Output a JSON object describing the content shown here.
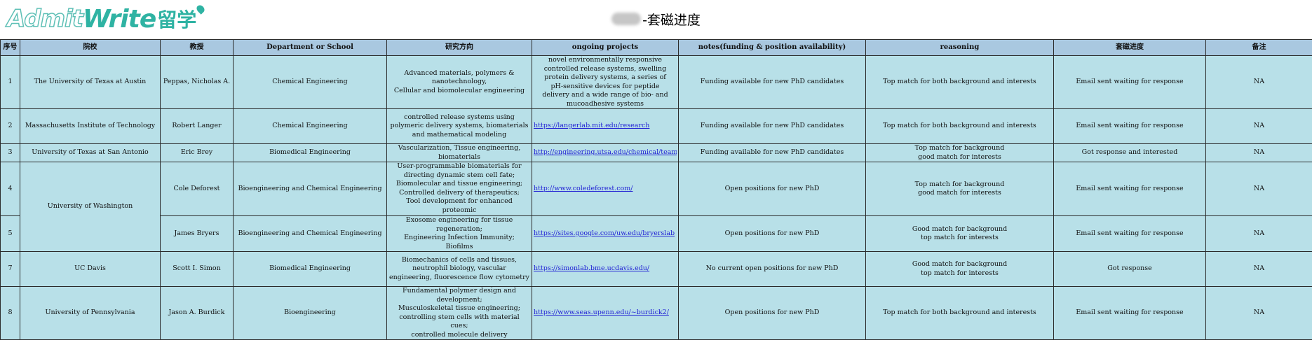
{
  "logo": {
    "admit": "Admit",
    "write": "Write",
    "cn": "留学"
  },
  "title": "-套磁进度",
  "headers": {
    "no": "序号",
    "school": "院校",
    "prof": "教授",
    "dept": "Department or School",
    "research": "研究方向",
    "projects": "ongoing projects",
    "notes": "notes(funding & position availability)",
    "reasoning": "reasoning",
    "progress": "套磁进度",
    "remark": "备注"
  },
  "rows": [
    {
      "no": "1",
      "school": "The University of Texas at Austin",
      "prof": "Peppas, Nicholas A.",
      "dept": "Chemical Engineering",
      "research": "Advanced materials, polymers &\nnanotechnology,\nCellular and biomolecular engineering",
      "projects": "novel environmentally responsive\ncontrolled release systems, swelling\nprotein delivery systems, a series of\npH-sensitive devices for peptide\ndelivery and a wide range of bio- and\nmucoadhesive systems",
      "notes": "Funding available for new PhD candidates",
      "reasoning": "Top match for both background and interests",
      "progress": "Email sent waiting for response",
      "remark": "NA"
    },
    {
      "no": "2",
      "school": "Massachusetts Institute of Technology",
      "prof": "Robert Langer",
      "dept": "Chemical Engineering",
      "research": "controlled release systems using\npolymeric delivery systems, biomaterials\nand mathematical modeling",
      "projects": "https://langerlab.mit.edu/research",
      "notes": "Funding available for new PhD candidates",
      "reasoning": "Top match for both background and interests",
      "progress": "Email sent waiting for response",
      "remark": "NA"
    },
    {
      "no": "3",
      "school": "University of Texas at San Antonio",
      "prof": "Eric Brey",
      "dept": "Biomedical Engineering",
      "research": "Vascularization, Tissue engineering,\nbiomaterials",
      "projects": "http://engineering.utsa.edu/chemical/team",
      "notes": "Funding available for new PhD candidates",
      "reasoning": "Top match for background\ngood match for interests",
      "progress": "Got response and interested",
      "remark": "NA"
    },
    {
      "no": "4",
      "school": "University of Washington",
      "prof": "Cole Deforest",
      "dept": "Bioengineering and Chemical Engineering",
      "research": "User-programmable biomaterials for\ndirecting dynamic stem cell fate;\nBiomolecular and tissue engineering;\nControlled delivery of therapeutics;\nTool development for enhanced proteomic\nstudies",
      "projects": "http://www.coledeforest.com/",
      "notes": "Open positions for new PhD",
      "reasoning": "Top match for background\ngood match for interests",
      "progress": "Email sent waiting for response",
      "remark": "NA"
    },
    {
      "no": "5",
      "prof": "James Bryers",
      "dept": "Bioengineering and Chemical Engineering",
      "research": "Exosome engineering for tissue\nregeneration;\nEngineering Infection Immunity;\nBiofilms",
      "projects": "https://sites.google.com/uw.edu/bryerslab",
      "notes": "Open positions for new PhD",
      "reasoning": "Good match for background\ntop match for interests",
      "progress": "Email sent waiting for response",
      "remark": "NA"
    },
    {
      "no": "7",
      "school": "UC Davis",
      "prof": "Scott I. Simon",
      "dept": "Biomedical Engineering",
      "research": "Biomechanics of cells and tissues,\nneutrophil biology, vascular\nengineering, fluorescence flow cytometry",
      "projects": "https://simonlab.bme.ucdavis.edu/",
      "notes": "No current open positions for new PhD",
      "reasoning": "Good match for background\ntop match for interests",
      "progress": "Got response",
      "remark": "NA"
    },
    {
      "no": "8",
      "school": "University of Pennsylvania",
      "prof": "Jason A. Burdick",
      "dept": "Bioengineering",
      "research": "Fundamental polymer design and\ndevelopment;\nMusculoskeletal tissue engineering;\ncontrolling stem cells with material\ncues;\ncontrolled molecule delivery",
      "projects": "https://www.seas.upenn.edu/~burdick2/",
      "notes": "Open positions for new PhD",
      "reasoning": "Top match for both background and interests",
      "progress": "Email sent waiting for response",
      "remark": "NA"
    }
  ]
}
